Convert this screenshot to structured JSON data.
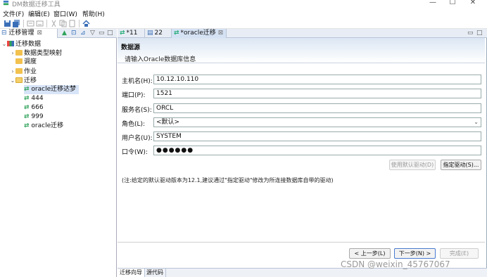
{
  "window": {
    "title": "DM数据迁移工具",
    "controls": {
      "minimize": "—",
      "maximize": "☐",
      "close": "✕"
    }
  },
  "menubar": {
    "items": [
      "文件(F)",
      "编辑(E)",
      "窗口(W)",
      "帮助(H)"
    ]
  },
  "left_panel": {
    "tab_label": "迁移管理",
    "tab_close": "⊠",
    "tree": [
      {
        "label": "迁移数据",
        "expanded": true
      },
      {
        "label": "数据类型映射"
      },
      {
        "label": "调度"
      },
      {
        "label": "作业"
      },
      {
        "label": "迁移",
        "expanded": true
      },
      {
        "label": "oracle迁移达梦",
        "selected": true
      },
      {
        "label": "444"
      },
      {
        "label": "666"
      },
      {
        "label": "999"
      },
      {
        "label": "oracle迁移"
      }
    ]
  },
  "editor_tabs": [
    {
      "label": "*11"
    },
    {
      "label": "22"
    },
    {
      "label": "*oracle迁移",
      "active": true
    }
  ],
  "editor_tab_close": "⊠",
  "page": {
    "title": "数据源",
    "description": "请输入Oracle数据库信息",
    "fields": {
      "host": {
        "label": "主机名(H):",
        "value": "10.12.10.110"
      },
      "port": {
        "label": "端口(P):",
        "value": "1521"
      },
      "service": {
        "label": "服务名(S):",
        "value": "ORCL"
      },
      "role": {
        "label": "角色(L):",
        "value": "<默认>"
      },
      "user": {
        "label": "用户名(U):",
        "value": "SYSTEM"
      },
      "password": {
        "label": "口令(W):",
        "value": "●●●●●●"
      }
    },
    "use_default_driver": "使用默认驱动(D)",
    "specify_driver": "指定驱动(S)...",
    "note": "(注:给定的默认驱动版本为12.1,建议通过\"指定驱动\"修改为所连接数据库自带的驱动)"
  },
  "wizard_buttons": {
    "prev": "< 上一步(L)",
    "next": "下一步(N) >",
    "finish": "完成(E)"
  },
  "bottom_tabs": [
    "迁移向导",
    "源代码"
  ],
  "watermark": "CSDN @weixin_45767067"
}
